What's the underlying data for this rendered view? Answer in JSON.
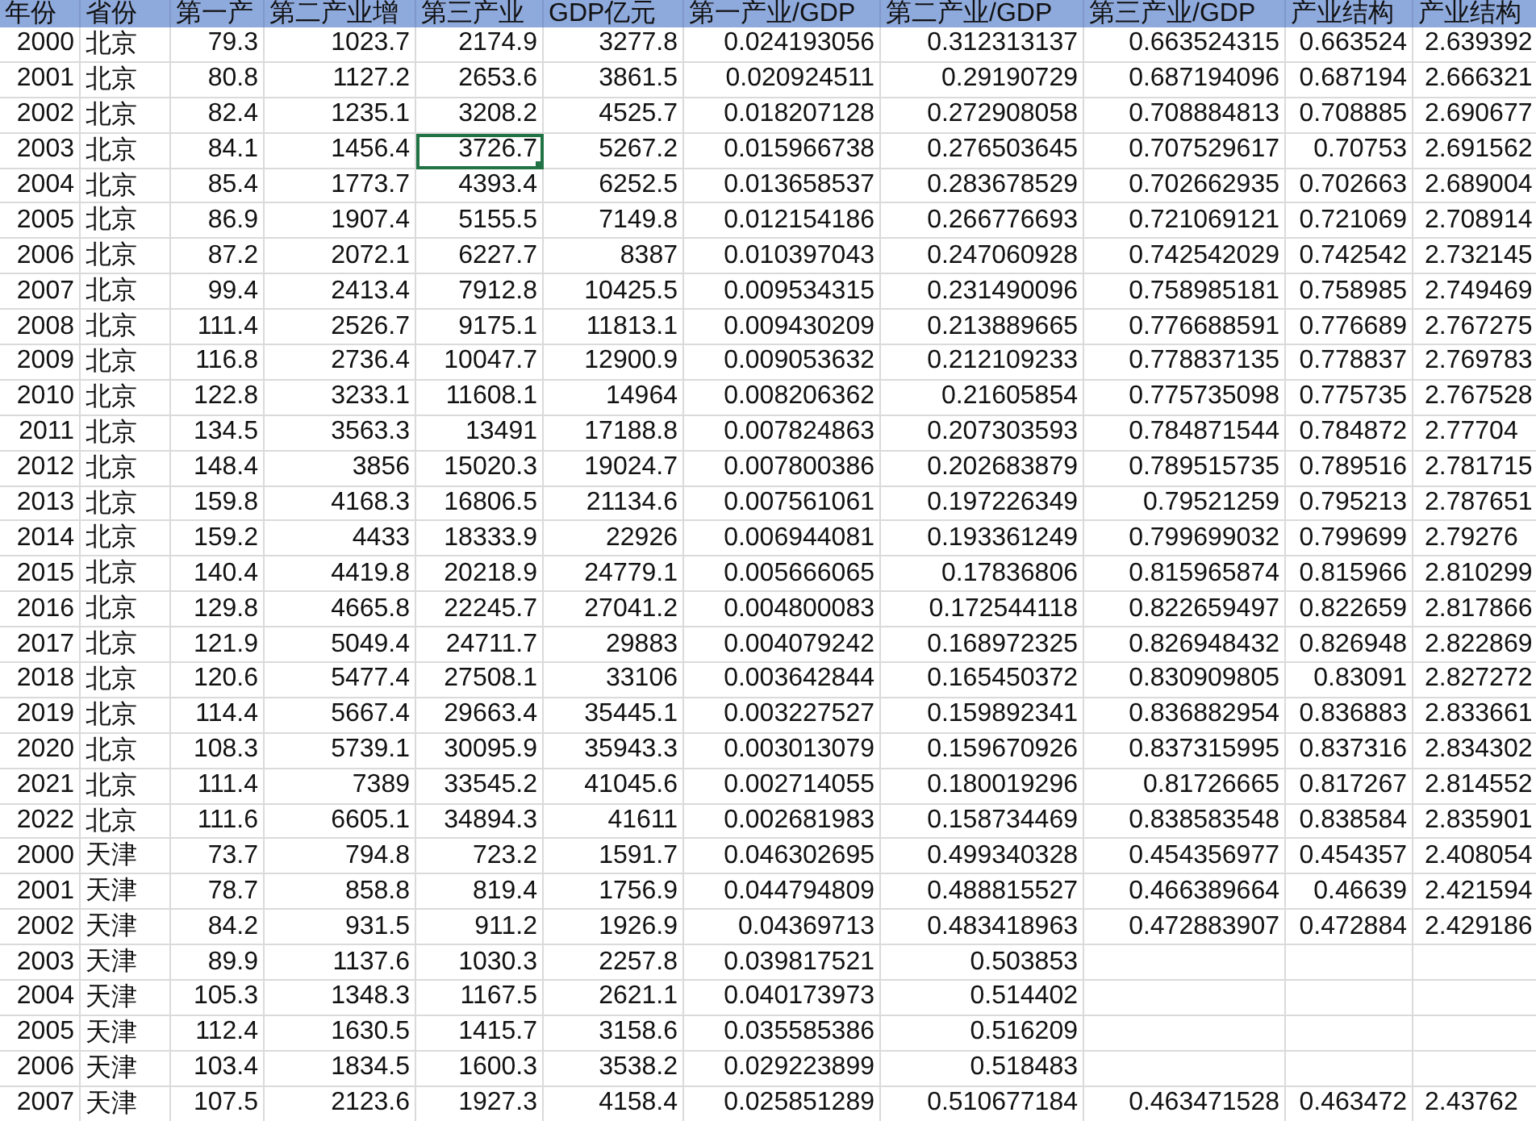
{
  "sheet": {
    "columns": [
      "年份",
      "省份",
      "第一产",
      "第二产业增",
      "第三产业",
      "GDP亿元",
      "第一产业/GDP",
      "第二产业/GDP",
      "第三产业/GDP",
      "产业结构",
      "产业结构"
    ],
    "rows": [
      {
        "selected": [
          false,
          false,
          false,
          false,
          false,
          false,
          false,
          false,
          false,
          false,
          false
        ],
        "cells": [
          "2000",
          "北京",
          "79.3",
          "1023.7",
          "2174.9",
          "3277.8",
          "0.024193056",
          "0.312313137",
          "0.663524315",
          "0.663524",
          "2.639392"
        ]
      },
      {
        "selected": [
          false,
          false,
          false,
          false,
          false,
          false,
          false,
          false,
          false,
          false,
          false
        ],
        "cells": [
          "2001",
          "北京",
          "80.8",
          "1127.2",
          "2653.6",
          "3861.5",
          "0.020924511",
          "0.29190729",
          "0.687194096",
          "0.687194",
          "2.666321"
        ]
      },
      {
        "selected": [
          false,
          false,
          false,
          false,
          false,
          false,
          false,
          false,
          false,
          false,
          false
        ],
        "cells": [
          "2002",
          "北京",
          "82.4",
          "1235.1",
          "3208.2",
          "4525.7",
          "0.018207128",
          "0.272908058",
          "0.708884813",
          "0.708885",
          "2.690677"
        ]
      },
      {
        "selected": [
          false,
          false,
          false,
          false,
          true,
          false,
          false,
          false,
          false,
          false,
          false
        ],
        "cells": [
          "2003",
          "北京",
          "84.1",
          "1456.4",
          "3726.7",
          "5267.2",
          "0.015966738",
          "0.276503645",
          "0.707529617",
          "0.70753",
          "2.691562"
        ]
      },
      {
        "selected": [
          false,
          false,
          false,
          false,
          false,
          false,
          false,
          false,
          false,
          false,
          false
        ],
        "cells": [
          "2004",
          "北京",
          "85.4",
          "1773.7",
          "4393.4",
          "6252.5",
          "0.013658537",
          "0.283678529",
          "0.702662935",
          "0.702663",
          "2.689004"
        ]
      },
      {
        "selected": [
          false,
          false,
          false,
          false,
          false,
          false,
          false,
          false,
          false,
          false,
          false
        ],
        "cells": [
          "2005",
          "北京",
          "86.9",
          "1907.4",
          "5155.5",
          "7149.8",
          "0.012154186",
          "0.266776693",
          "0.721069121",
          "0.721069",
          "2.708914"
        ]
      },
      {
        "selected": [
          false,
          false,
          false,
          false,
          false,
          false,
          false,
          false,
          false,
          false,
          false
        ],
        "cells": [
          "2006",
          "北京",
          "87.2",
          "2072.1",
          "6227.7",
          "8387",
          "0.010397043",
          "0.247060928",
          "0.742542029",
          "0.742542",
          "2.732145"
        ]
      },
      {
        "selected": [
          false,
          false,
          false,
          false,
          false,
          false,
          false,
          false,
          false,
          false,
          false
        ],
        "cells": [
          "2007",
          "北京",
          "99.4",
          "2413.4",
          "7912.8",
          "10425.5",
          "0.009534315",
          "0.231490096",
          "0.758985181",
          "0.758985",
          "2.749469"
        ]
      },
      {
        "selected": [
          false,
          false,
          false,
          false,
          false,
          false,
          false,
          false,
          false,
          false,
          false
        ],
        "cells": [
          "2008",
          "北京",
          "111.4",
          "2526.7",
          "9175.1",
          "11813.1",
          "0.009430209",
          "0.213889665",
          "0.776688591",
          "0.776689",
          "2.767275"
        ]
      },
      {
        "selected": [
          false,
          false,
          false,
          false,
          false,
          false,
          false,
          false,
          false,
          false,
          false
        ],
        "cells": [
          "2009",
          "北京",
          "116.8",
          "2736.4",
          "10047.7",
          "12900.9",
          "0.009053632",
          "0.212109233",
          "0.778837135",
          "0.778837",
          "2.769783"
        ]
      },
      {
        "selected": [
          false,
          false,
          false,
          false,
          false,
          false,
          false,
          false,
          false,
          false,
          false
        ],
        "cells": [
          "2010",
          "北京",
          "122.8",
          "3233.1",
          "11608.1",
          "14964",
          "0.008206362",
          "0.21605854",
          "0.775735098",
          "0.775735",
          "2.767528"
        ]
      },
      {
        "selected": [
          false,
          false,
          false,
          false,
          false,
          false,
          false,
          false,
          false,
          false,
          false
        ],
        "cells": [
          "2011",
          "北京",
          "134.5",
          "3563.3",
          "13491",
          "17188.8",
          "0.007824863",
          "0.207303593",
          "0.784871544",
          "0.784872",
          "2.77704"
        ]
      },
      {
        "selected": [
          false,
          false,
          false,
          false,
          false,
          false,
          false,
          false,
          false,
          false,
          false
        ],
        "cells": [
          "2012",
          "北京",
          "148.4",
          "3856",
          "15020.3",
          "19024.7",
          "0.007800386",
          "0.202683879",
          "0.789515735",
          "0.789516",
          "2.781715"
        ]
      },
      {
        "selected": [
          false,
          false,
          false,
          false,
          false,
          false,
          false,
          false,
          false,
          false,
          false
        ],
        "cells": [
          "2013",
          "北京",
          "159.8",
          "4168.3",
          "16806.5",
          "21134.6",
          "0.007561061",
          "0.197226349",
          "0.79521259",
          "0.795213",
          "2.787651"
        ]
      },
      {
        "selected": [
          false,
          false,
          false,
          false,
          false,
          false,
          false,
          false,
          false,
          false,
          false
        ],
        "cells": [
          "2014",
          "北京",
          "159.2",
          "4433",
          "18333.9",
          "22926",
          "0.006944081",
          "0.193361249",
          "0.799699032",
          "0.799699",
          "2.79276"
        ]
      },
      {
        "selected": [
          false,
          false,
          false,
          false,
          false,
          false,
          false,
          false,
          false,
          false,
          false
        ],
        "cells": [
          "2015",
          "北京",
          "140.4",
          "4419.8",
          "20218.9",
          "24779.1",
          "0.005666065",
          "0.17836806",
          "0.815965874",
          "0.815966",
          "2.810299"
        ]
      },
      {
        "selected": [
          false,
          false,
          false,
          false,
          false,
          false,
          false,
          false,
          false,
          false,
          false
        ],
        "cells": [
          "2016",
          "北京",
          "129.8",
          "4665.8",
          "22245.7",
          "27041.2",
          "0.004800083",
          "0.172544118",
          "0.822659497",
          "0.822659",
          "2.817866"
        ]
      },
      {
        "selected": [
          false,
          false,
          false,
          false,
          false,
          false,
          false,
          false,
          false,
          false,
          false
        ],
        "cells": [
          "2017",
          "北京",
          "121.9",
          "5049.4",
          "24711.7",
          "29883",
          "0.004079242",
          "0.168972325",
          "0.826948432",
          "0.826948",
          "2.822869"
        ]
      },
      {
        "selected": [
          false,
          false,
          false,
          false,
          false,
          false,
          false,
          false,
          false,
          false,
          false
        ],
        "cells": [
          "2018",
          "北京",
          "120.6",
          "5477.4",
          "27508.1",
          "33106",
          "0.003642844",
          "0.165450372",
          "0.830909805",
          "0.83091",
          "2.827272"
        ]
      },
      {
        "selected": [
          false,
          false,
          false,
          false,
          false,
          false,
          false,
          false,
          false,
          false,
          false
        ],
        "cells": [
          "2019",
          "北京",
          "114.4",
          "5667.4",
          "29663.4",
          "35445.1",
          "0.003227527",
          "0.159892341",
          "0.836882954",
          "0.836883",
          "2.833661"
        ]
      },
      {
        "selected": [
          false,
          false,
          false,
          false,
          false,
          false,
          false,
          false,
          false,
          false,
          false
        ],
        "cells": [
          "2020",
          "北京",
          "108.3",
          "5739.1",
          "30095.9",
          "35943.3",
          "0.003013079",
          "0.159670926",
          "0.837315995",
          "0.837316",
          "2.834302"
        ]
      },
      {
        "selected": [
          false,
          false,
          false,
          false,
          false,
          false,
          false,
          false,
          false,
          false,
          false
        ],
        "cells": [
          "2021",
          "北京",
          "111.4",
          "7389",
          "33545.2",
          "41045.6",
          "0.002714055",
          "0.180019296",
          "0.81726665",
          "0.817267",
          "2.814552"
        ]
      },
      {
        "selected": [
          false,
          false,
          false,
          false,
          false,
          false,
          false,
          false,
          false,
          false,
          false
        ],
        "cells": [
          "2022",
          "北京",
          "111.6",
          "6605.1",
          "34894.3",
          "41611",
          "0.002681983",
          "0.158734469",
          "0.838583548",
          "0.838584",
          "2.835901"
        ]
      },
      {
        "selected": [
          false,
          false,
          false,
          false,
          false,
          false,
          false,
          false,
          false,
          false,
          false
        ],
        "cells": [
          "2000",
          "天津",
          "73.7",
          "794.8",
          "723.2",
          "1591.7",
          "0.046302695",
          "0.499340328",
          "0.454356977",
          "0.454357",
          "2.408054"
        ]
      },
      {
        "selected": [
          false,
          false,
          false,
          false,
          false,
          false,
          false,
          false,
          false,
          false,
          false
        ],
        "cells": [
          "2001",
          "天津",
          "78.7",
          "858.8",
          "819.4",
          "1756.9",
          "0.044794809",
          "0.488815527",
          "0.466389664",
          "0.46639",
          "2.421594"
        ]
      },
      {
        "selected": [
          false,
          false,
          false,
          false,
          false,
          false,
          false,
          false,
          false,
          false,
          false
        ],
        "cells": [
          "2002",
          "天津",
          "84.2",
          "931.5",
          "911.2",
          "1926.9",
          "0.04369713",
          "0.483418963",
          "0.472883907",
          "0.472884",
          "2.429186"
        ]
      },
      {
        "selected": [
          false,
          false,
          false,
          false,
          false,
          false,
          false,
          false,
          false,
          false,
          false
        ],
        "cells": [
          "2003",
          "天津",
          "89.9",
          "1137.6",
          "1030.3",
          "2257.8",
          "0.039817521",
          "0.503853",
          null,
          null,
          null
        ]
      },
      {
        "selected": [
          false,
          false,
          false,
          false,
          false,
          false,
          false,
          false,
          false,
          false,
          false
        ],
        "cells": [
          "2004",
          "天津",
          "105.3",
          "1348.3",
          "1167.5",
          "2621.1",
          "0.040173973",
          "0.514402",
          null,
          null,
          null
        ]
      },
      {
        "selected": [
          false,
          false,
          false,
          false,
          false,
          false,
          false,
          false,
          false,
          false,
          false
        ],
        "cells": [
          "2005",
          "天津",
          "112.4",
          "1630.5",
          "1415.7",
          "3158.6",
          "0.035585386",
          "0.516209",
          null,
          null,
          null
        ]
      },
      {
        "selected": [
          false,
          false,
          false,
          false,
          false,
          false,
          false,
          false,
          false,
          false,
          false
        ],
        "cells": [
          "2006",
          "天津",
          "103.4",
          "1834.5",
          "1600.3",
          "3538.2",
          "0.029223899",
          "0.518483",
          null,
          null,
          null
        ]
      },
      {
        "selected": [
          false,
          false,
          false,
          false,
          false,
          false,
          false,
          false,
          false,
          false,
          false
        ],
        "cells": [
          "2007",
          "天津",
          "107.5",
          "2123.6",
          "1927.3",
          "4158.4",
          "0.025851289",
          "0.510677184",
          "0.463471528",
          "0.463472",
          "2.43762"
        ]
      }
    ]
  }
}
